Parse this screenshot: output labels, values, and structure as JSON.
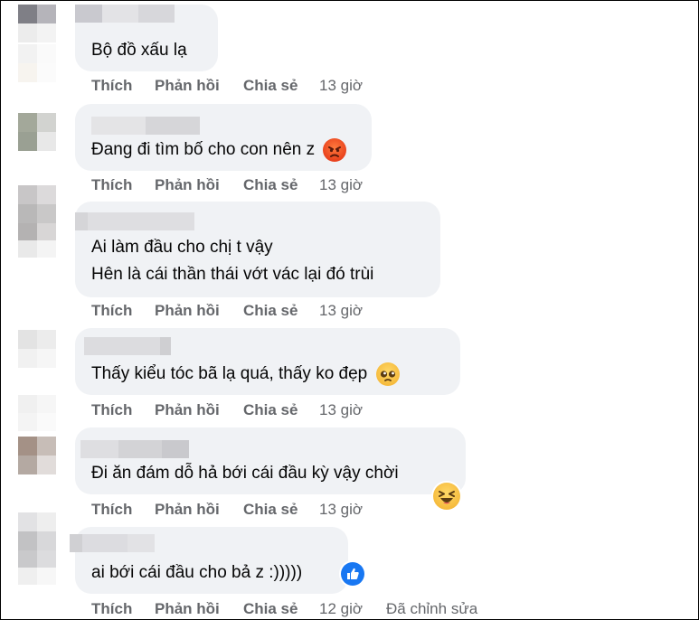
{
  "actions": {
    "like": "Thích",
    "reply": "Phản hồi",
    "share": "Chia sẻ"
  },
  "comments": [
    {
      "lines": [
        "Bộ đồ xấu lạ"
      ],
      "time": "13 giờ"
    },
    {
      "lines": [
        "Đang đi tìm bố cho con nên z"
      ],
      "emoji": "angry-face",
      "time": "13 giờ"
    },
    {
      "lines": [
        "Ai làm đầu cho chị t vậy",
        "Hên là cái thần thái vớt vác lại đó trùi"
      ],
      "time": "13 giờ"
    },
    {
      "lines": [
        "Thấy kiểu tóc bã lạ quá, thấy ko đẹp"
      ],
      "emoji": "pleading-face",
      "time": "13 giờ"
    },
    {
      "lines": [
        "Đi ăn đám dỗ hả bới cái đầu kỳ vậy chời"
      ],
      "emoji": "laughing-face",
      "time": "13 giờ"
    },
    {
      "lines": [
        "ai bới cái đầu cho bả z :)))))"
      ],
      "emoji": "like-reaction",
      "time": "12 giờ",
      "edited": "Đã chỉnh sửa"
    }
  ],
  "colors": {
    "bubble": "#f0f2f5",
    "text": "#050505",
    "meta": "#65676b",
    "like_blue": "#1877f2"
  }
}
